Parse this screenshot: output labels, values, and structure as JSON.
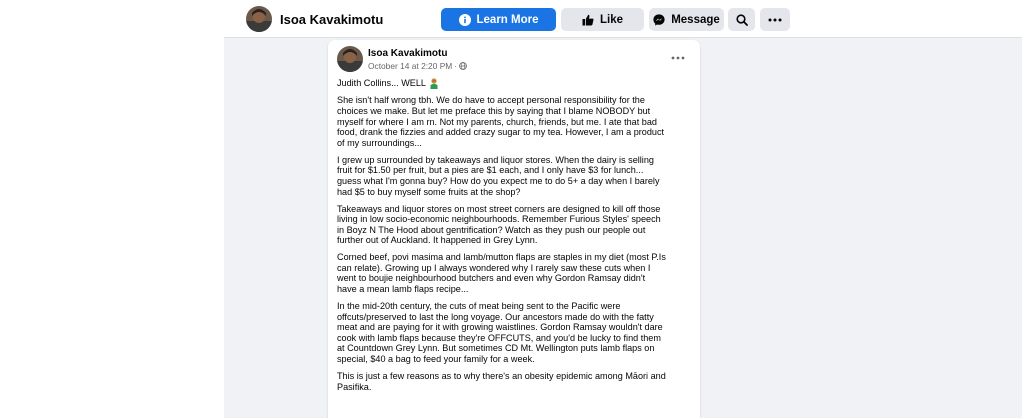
{
  "page": {
    "name": "Isoa Kavakimotu"
  },
  "topbar": {
    "learn_more": "Learn More",
    "like": "Like",
    "message": "Message",
    "icons": [
      "info-icon",
      "thumbs-up-icon",
      "messenger-icon",
      "search-icon",
      "more-icon"
    ]
  },
  "post": {
    "author": "Isoa Kavakimotu",
    "timestamp": "October 14 at 2:20 PM",
    "separator": "·",
    "audience_icon": "globe-icon",
    "more_icon": "more-horizontal-icon",
    "first_line": "Judith Collins... WELL",
    "first_line_emoji": "person-facepalming-icon",
    "paragraphs": [
      "She isn't half wrong tbh. We do have to accept personal responsibility for the\nchoices we make. But let me preface this by saying that I blame NOBODY but\nmyself for where I am rn. Not my parents, church, friends, but me. I ate that bad\nfood, drank the fizzies and added crazy sugar to my tea. However, I am a product\nof my surroundings...",
      "I grew up surrounded by takeaways and liquor stores. When the dairy is selling\nfruit for $1.50 per fruit, but a pies are $1 each, and I only have $3 for lunch...\nguess what I'm gonna buy? How do you expect me to do 5+ a day when I barely\nhad $5 to buy myself some fruits at the shop?",
      "Takeaways and liquor stores on most street corners are designed to kill off those\nliving in low socio-economic neighbourhoods. Remember Furious Styles' speech\nin Boyz N The Hood about gentrification? Watch as they push our people out\nfurther out of Auckland. It happened in Grey Lynn.",
      "Corned beef, povi masima and lamb/mutton flaps are staples in my diet (most P.Is\ncan relate). Growing up I always wondered why I rarely saw these cuts when I\nwent to boujie neighbourhood butchers and even why Gordon Ramsay didn't\nhave a mean lamb flaps recipe...",
      "In the mid-20th century, the cuts of meat being sent to the Pacific were\noffcuts/preserved to last the long voyage. Our ancestors made do with the fatty\nmeat and are paying for it with growing waistlines. Gordon Ramsay wouldn't dare\ncook with lamb flaps because they're OFFCUTS, and you'd be lucky to find them\nat Countdown Grey Lynn. But sometimes CD Mt. Wellington puts lamb flaps on\nspecial, $40 a bag to feed your family for a week.",
      "This is just a few reasons as to why there's an obesity epidemic among Māori and\nPasifika."
    ]
  },
  "colors": {
    "primary_blue": "#1b74e4",
    "button_grey": "#e4e6eb",
    "page_bg": "#f0f2f5",
    "meta_grey": "#65676b"
  }
}
